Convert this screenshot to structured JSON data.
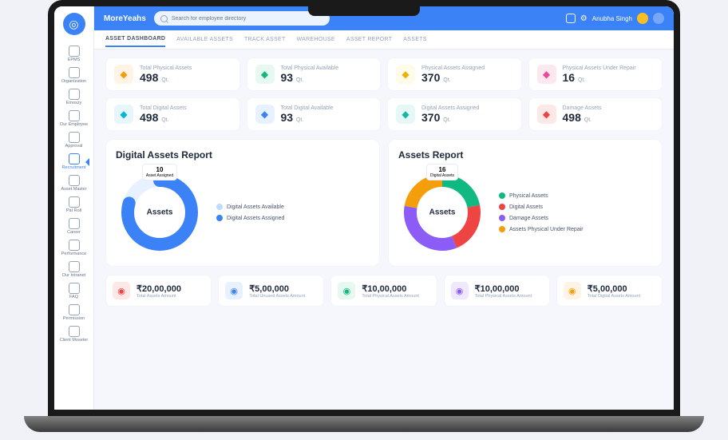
{
  "brand": "MoreYeahs",
  "search": {
    "placeholder": "Search for employee directory"
  },
  "user": {
    "name": "Anubha Singh"
  },
  "sidebar": {
    "items": [
      {
        "label": "EPMS"
      },
      {
        "label": "Organization"
      },
      {
        "label": "Emoxzy"
      },
      {
        "label": "Our Employee"
      },
      {
        "label": "Approval"
      },
      {
        "label": "Recruitment"
      },
      {
        "label": "Asset Master"
      },
      {
        "label": "Pat Roll"
      },
      {
        "label": "Career"
      },
      {
        "label": "Performance"
      },
      {
        "label": "Our Intranet"
      },
      {
        "label": "FAQ"
      },
      {
        "label": "Permission"
      },
      {
        "label": "Client Moseter"
      }
    ],
    "activeIndex": 5
  },
  "tabs": {
    "items": [
      "ASSET DASHBOARD",
      "AVAILABLE ASSETS",
      "TRACK ASSET",
      "WAREHOUSE",
      "ASSET REPORT",
      "ASSETS"
    ],
    "activeIndex": 0
  },
  "metrics": [
    {
      "title": "Total Physical Assets",
      "value": "498",
      "unit": "Qt.",
      "icon": "orange"
    },
    {
      "title": "Total Physical Available",
      "value": "93",
      "unit": "Qt.",
      "icon": "green"
    },
    {
      "title": "Physical Assets Assigned",
      "value": "370",
      "unit": "Qt.",
      "icon": "yellow"
    },
    {
      "title": "Physical Assets Under Repair",
      "value": "16",
      "unit": "Qt.",
      "icon": "pink"
    },
    {
      "title": "Total Digital Assets",
      "value": "498",
      "unit": "Qt.",
      "icon": "cyan"
    },
    {
      "title": "Total Digital Available",
      "value": "93",
      "unit": "Qt.",
      "icon": "blue"
    },
    {
      "title": "Digital Assets Assigned",
      "value": "370",
      "unit": "Qt.",
      "icon": "teal"
    },
    {
      "title": "Damage Assets",
      "value": "498",
      "unit": "Qt.",
      "icon": "red"
    }
  ],
  "chart1": {
    "title": "Digital Assets Report",
    "center": "Assets",
    "tip": {
      "value": "10",
      "label": "Asset Assigned"
    },
    "legend": [
      {
        "label": "Digital Assets Available",
        "color": "#bfdbfe"
      },
      {
        "label": "Digital Assets Assigned",
        "color": "#3b82f6"
      }
    ]
  },
  "chart2": {
    "title": "Assets Report",
    "center": "Assets",
    "tip": {
      "value": "16",
      "label": "Digital Assets"
    },
    "legend": [
      {
        "label": "Physical Assets",
        "color": "#10b981"
      },
      {
        "label": "Digital Assets",
        "color": "#ef4444"
      },
      {
        "label": "Damage Assets",
        "color": "#8b5cf6"
      },
      {
        "label": "Assets Physical Under Repair",
        "color": "#f59e0b"
      }
    ]
  },
  "chart_data": [
    {
      "type": "pie",
      "title": "Digital Assets Report",
      "series": [
        {
          "name": "Digital Assets Available",
          "value": 20
        },
        {
          "name": "Digital Assets Assigned",
          "value": 80
        }
      ]
    },
    {
      "type": "pie",
      "title": "Assets Report",
      "series": [
        {
          "name": "Physical Assets",
          "value": 22
        },
        {
          "name": "Digital Assets",
          "value": 22
        },
        {
          "name": "Damage Assets",
          "value": 34
        },
        {
          "name": "Assets Physical Under Repair",
          "value": 22
        }
      ]
    }
  ],
  "amounts": [
    {
      "value": "₹20,00,000",
      "label": "Total Assets Amount",
      "icon": "ai-red"
    },
    {
      "value": "₹5,00,000",
      "label": "Total Unused Assets Amount",
      "icon": "ai-blue"
    },
    {
      "value": "₹10,00,000",
      "label": "Total Physical Assets Amount",
      "icon": "ai-green"
    },
    {
      "value": "₹10,00,000",
      "label": "Total Physical Assets Amount",
      "icon": "ai-purple"
    },
    {
      "value": "₹5,00,000",
      "label": "Total Digital Assets Amount",
      "icon": "ai-orange"
    }
  ]
}
